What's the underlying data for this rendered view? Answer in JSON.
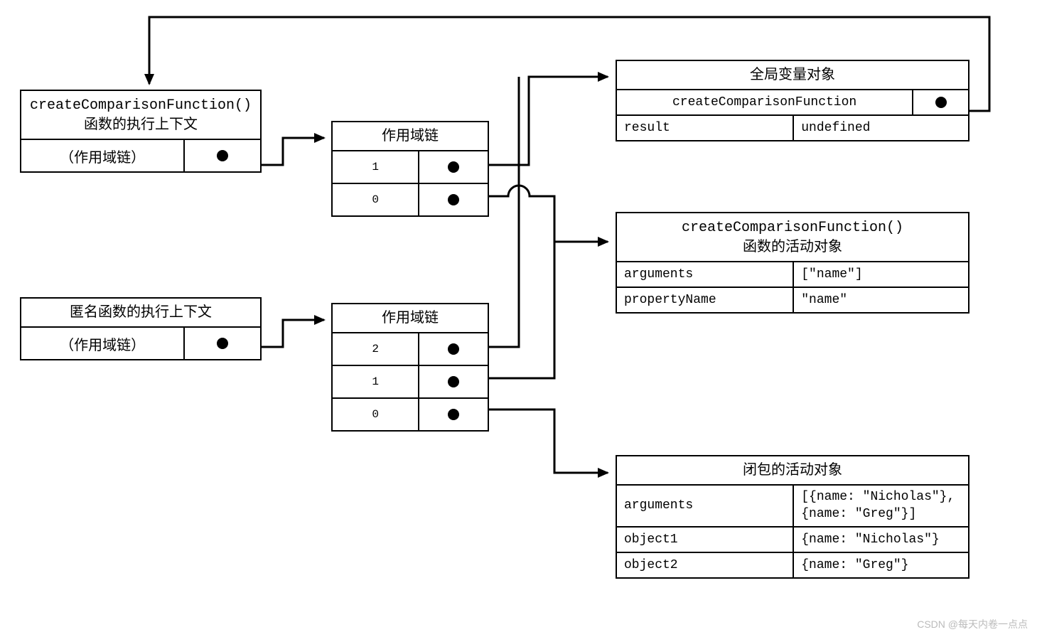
{
  "ctx1": {
    "title_line1": "createComparisonFunction()",
    "title_line2": "函数的执行上下文",
    "scope_label": "（作用域链）"
  },
  "ctx2": {
    "title": "匿名函数的执行上下文",
    "scope_label": "（作用域链）"
  },
  "scope1": {
    "title": "作用域链",
    "entries": [
      "1",
      "0"
    ]
  },
  "scope2": {
    "title": "作用域链",
    "entries": [
      "2",
      "1",
      "0"
    ]
  },
  "global_obj": {
    "title": "全局变量对象",
    "rows": [
      {
        "k": "createComparisonFunction",
        "dot": true
      },
      {
        "k": "result",
        "v": "undefined"
      }
    ]
  },
  "ccf_active": {
    "title_line1": "createComparisonFunction()",
    "title_line2": "函数的活动对象",
    "rows": [
      {
        "k": "arguments",
        "v": "[\"name\"]"
      },
      {
        "k": "propertyName",
        "v": "\"name\""
      }
    ]
  },
  "closure_active": {
    "title": "闭包的活动对象",
    "rows": [
      {
        "k": "arguments",
        "v": "[{name: \"Nicholas\"},\n{name: \"Greg\"}]"
      },
      {
        "k": "object1",
        "v": "{name: \"Nicholas\"}"
      },
      {
        "k": "object2",
        "v": "{name: \"Greg\"}"
      }
    ]
  },
  "watermark": "CSDN @每天内卷一点点"
}
